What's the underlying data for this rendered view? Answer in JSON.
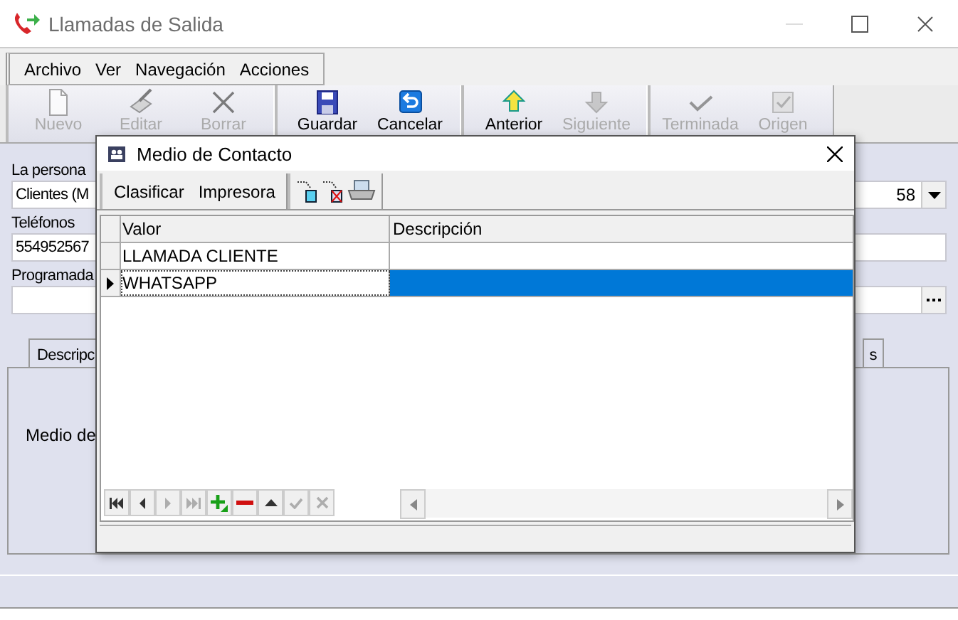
{
  "window": {
    "title": "Llamadas de Salida"
  },
  "menu": [
    "Archivo",
    "Ver",
    "Navegación",
    "Acciones"
  ],
  "toolbar": [
    [
      {
        "label": "Nuevo",
        "kind": "new",
        "disabled": true
      },
      {
        "label": "Editar",
        "kind": "edit",
        "disabled": true
      },
      {
        "label": "Borrar",
        "kind": "delete",
        "disabled": true
      }
    ],
    [
      {
        "label": "Guardar",
        "kind": "save",
        "disabled": false
      },
      {
        "label": "Cancelar",
        "kind": "cancel",
        "disabled": false
      }
    ],
    [
      {
        "label": "Anterior",
        "kind": "prior",
        "disabled": false
      },
      {
        "label": "Siguiente",
        "kind": "next",
        "disabled": true
      }
    ],
    [
      {
        "label": "Terminada",
        "kind": "done",
        "disabled": true
      },
      {
        "label": "Origen",
        "kind": "origin",
        "disabled": true
      }
    ]
  ],
  "fields": [
    {
      "label": "La persona",
      "value": "Clientes (M",
      "tail": "58",
      "kind": "dropdown"
    },
    {
      "label": "Teléfonos",
      "value": "554952567",
      "kind": "text"
    },
    {
      "label": "Programada",
      "kind": "ellipsis"
    }
  ],
  "tabs": [
    {
      "label": "Descripc",
      "selected": true
    },
    {
      "label": "s",
      "selected": false
    }
  ],
  "panel_label": "Medio de",
  "dialog": {
    "title": "Medio de Contacto",
    "toolbar": [
      "Clasificar",
      "Impresora"
    ],
    "columns": [
      "Valor",
      "Descripción"
    ],
    "rows": [
      {
        "valor": "LLAMADA CLIENTE",
        "selected": false
      },
      {
        "valor": "WHATSAPP",
        "selected": true
      }
    ],
    "navigator": [
      {
        "kind": "first",
        "disabled": false
      },
      {
        "kind": "prior",
        "disabled": false
      },
      {
        "kind": "next",
        "disabled": true
      },
      {
        "kind": "last",
        "disabled": true
      },
      {
        "kind": "insert",
        "disabled": false
      },
      {
        "kind": "delete",
        "disabled": false
      },
      {
        "kind": "edit",
        "disabled": false
      },
      {
        "kind": "post",
        "disabled": true
      },
      {
        "kind": "cancel",
        "disabled": true
      }
    ]
  }
}
